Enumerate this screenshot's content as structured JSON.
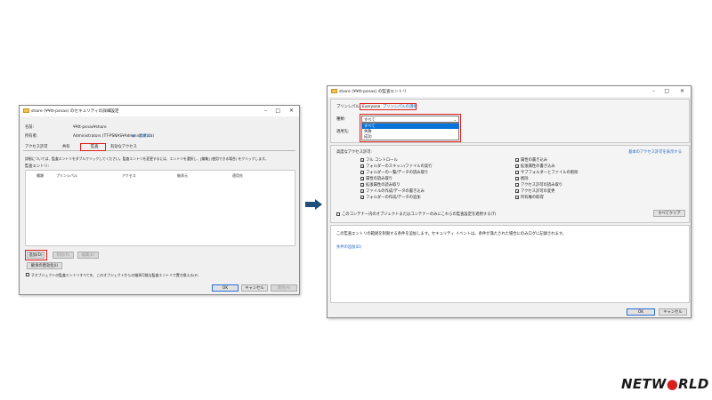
{
  "left_window": {
    "title": "share (¥¥tt-psnas) のセキュリティの詳細設定",
    "name_label": "名前:",
    "name_value": "¥¥tt-psnas¥share",
    "owner_label": "所有者:",
    "owner_value": "Administrators (TT-PSNAS¥Administrators)",
    "change_link": "変更(C)",
    "tabs": [
      "アクセス許可",
      "共有",
      "監査",
      "有効なアクセス"
    ],
    "instruction": "詳細については、監査エントリをダブルクリックしてください。監査エントリを変更するには、エントリを選択し、[編集] (使用できる場合) をクリックします。",
    "entries_label": "監査エントリ:",
    "columns": [
      "種類",
      "プリンシパル",
      "アクセス",
      "継承元",
      "適用先"
    ],
    "add_button": "追加(D)",
    "remove_button": "削除(R)",
    "edit_button": "編集(E)",
    "disable_inherit_button": "継承の無効化(I)",
    "replace_checkbox": "子オブジェクトの監査エントリすべてを、このオブジェクトからの継承可能な監査エントリで置き換える(P)",
    "ok": "OK",
    "cancel": "キャンセル",
    "apply": "適用(A)"
  },
  "arrow": {
    "color": "#1f4e79"
  },
  "right_window": {
    "title": "share (¥¥tt-psnas) の監査エントリ",
    "principal_label": "プリンシパル:",
    "principal_value": "Everyone",
    "select_principal_link": "プリンシパルの選択",
    "type_label": "種類:",
    "type_selected": "すべて",
    "type_options": [
      "すべて",
      "失敗",
      "成功"
    ],
    "applies_label": "適用先:",
    "advanced_label": "高度なアクセス許可:",
    "basic_link": "基本のアクセス許可を表示する",
    "permissions_left": [
      "フル コントロール",
      "フォルダーのスキャン/ファイルの実行",
      "フォルダーの一覧/データの読み取り",
      "属性の読み取り",
      "拡張属性の読み取り",
      "ファイルの作成/データの書き込み",
      "フォルダーの作成/データの追加"
    ],
    "permissions_right": [
      "属性の書き込み",
      "拡張属性の書き込み",
      "サブフォルダーとファイルの削除",
      "削除",
      "アクセス許可の読み取り",
      "アクセス許可の変更",
      "所有権の取得"
    ],
    "apply_only_checkbox": "このコンテナー内のオブジェクトまたはコンテナーのみにこれらの監査設定を適用する(T)",
    "clear_all_button": "すべてクリア",
    "condition_text": "この監査エントリの範囲を制限する条件を追加します。セキュリティ イベントは、条件が満たされた場合にのみログに記録されます。",
    "add_condition_link": "条件の追加(D)",
    "ok": "OK",
    "cancel": "キャンセル"
  },
  "logo": {
    "text": "NETW●RLD",
    "color": "#1a1a1a",
    "accent": "#d6201c"
  }
}
